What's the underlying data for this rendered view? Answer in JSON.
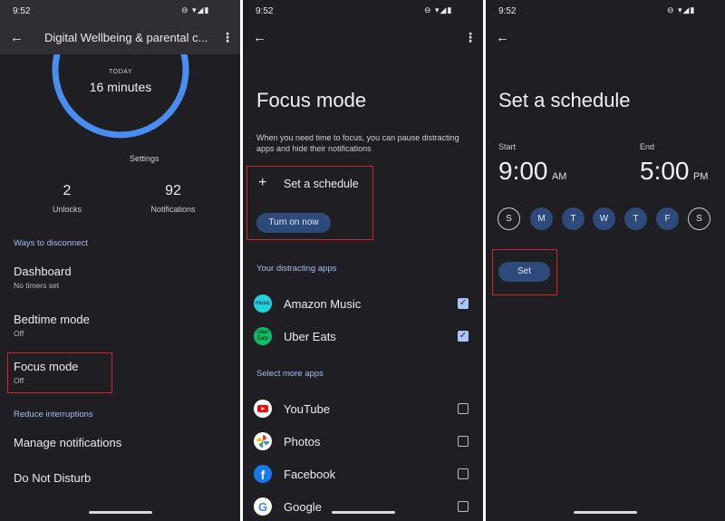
{
  "status": {
    "time": "9:52",
    "icons": "⊖ ▾◢▮"
  },
  "screen1": {
    "title": "Digital Wellbeing & parental c...",
    "ring": {
      "today_label": "TODAY",
      "minutes": "16 minutes"
    },
    "settings_label": "Settings",
    "stats": [
      {
        "value": "2",
        "label": "Unlocks"
      },
      {
        "value": "92",
        "label": "Notifications"
      }
    ],
    "section_disconnect": "Ways to disconnect",
    "items": [
      {
        "title": "Dashboard",
        "sub": "No timers set"
      },
      {
        "title": "Bedtime mode",
        "sub": "Off"
      },
      {
        "title": "Focus mode",
        "sub": "Off"
      }
    ],
    "section_reduce": "Reduce interruptions",
    "manage_notifications": "Manage notifications",
    "do_not_disturb": "Do Not Disturb"
  },
  "screen2": {
    "heading": "Focus mode",
    "description": "When you need time to focus, you can pause distracting apps and hide their notifications",
    "set_schedule": "Set a schedule",
    "turn_on_now": "Turn on now",
    "section_distracting": "Your distracting apps",
    "distracting_apps": [
      {
        "name": "Amazon Music",
        "icon_text": "music",
        "checked": true,
        "color": "#25d1da"
      },
      {
        "name": "Uber Eats",
        "icon_text": "Uber Eats",
        "checked": true,
        "color": "#06c167"
      }
    ],
    "section_more": "Select more apps",
    "more_apps": [
      {
        "name": "YouTube",
        "checked": false,
        "color": "#ffffff"
      },
      {
        "name": "Photos",
        "checked": false,
        "color": "#ffffff"
      },
      {
        "name": "Facebook",
        "checked": false,
        "color": "#1877f2"
      },
      {
        "name": "Google",
        "checked": false,
        "color": "#ffffff"
      }
    ]
  },
  "screen3": {
    "heading": "Set a schedule",
    "start_label": "Start",
    "start_time": "9:00",
    "start_ampm": "AM",
    "end_label": "End",
    "end_time": "5:00",
    "end_ampm": "PM",
    "days": [
      {
        "label": "S",
        "selected": false
      },
      {
        "label": "M",
        "selected": true
      },
      {
        "label": "T",
        "selected": true
      },
      {
        "label": "W",
        "selected": true
      },
      {
        "label": "T",
        "selected": true
      },
      {
        "label": "F",
        "selected": true
      },
      {
        "label": "S",
        "selected": false
      }
    ],
    "set_button": "Set"
  },
  "colors": {
    "background": "#1f1f23",
    "accent": "#2e4a7a",
    "ring": "#4a8df0",
    "highlight": "#d0262f",
    "section": "#a7bdf0"
  }
}
